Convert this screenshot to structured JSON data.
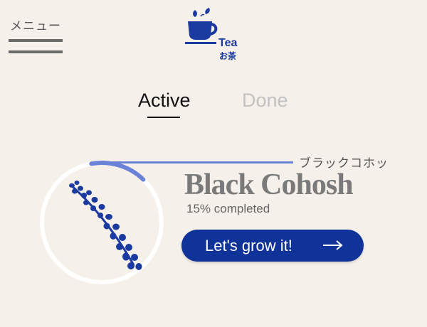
{
  "menu": {
    "label": "メニュー"
  },
  "logo": {
    "name": "Tea",
    "name_jp": "お茶",
    "icon": "teacup-icon"
  },
  "tabs": [
    {
      "label": "Active",
      "selected": true
    },
    {
      "label": "Done",
      "selected": false
    }
  ],
  "plant": {
    "name": "Black Cohosh",
    "name_jp": "ブラックコホッ",
    "progress_text": "15% completed",
    "progress": 0.15,
    "icon": "black-cohosh-sprig-icon"
  },
  "action": {
    "label": "Let's grow it!",
    "icon": "arrow-right-icon"
  },
  "colors": {
    "background": "#f5f0ea",
    "accent": "#10339a",
    "progress_arc": "#6a83d6",
    "tab_inactive": "#c2c2c2"
  }
}
